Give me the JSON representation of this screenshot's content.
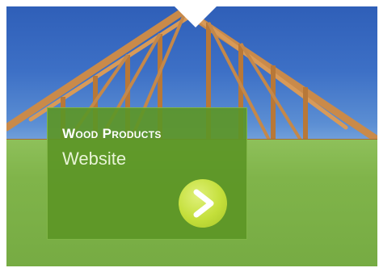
{
  "banner": {
    "title": "Wood Products",
    "subtitle": "Website",
    "button_icon": "chevron-right-icon",
    "colors": {
      "panel": "#5c9626",
      "button": "#c4df3a",
      "sky": "#3d70c6",
      "grass": "#80b44a"
    }
  }
}
